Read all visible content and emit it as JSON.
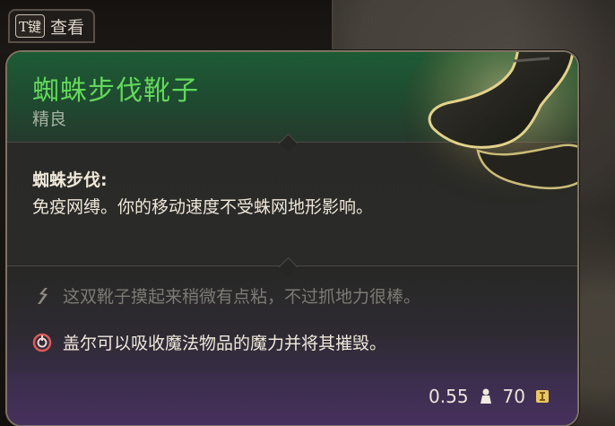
{
  "key_hint": {
    "key": "T键",
    "label": "查看"
  },
  "item": {
    "name": "蜘蛛步伐靴子",
    "rarity": "精良",
    "passive_name": "蜘蛛步伐:",
    "passive_desc": "免疫网缚。你的移动速度不受蛛网地形影响。",
    "flavor_text": "这双靴子摸起来稍微有点粘，不过抓地力很棒。",
    "note_text": "盖尔可以吸收魔法物品的魔力并将其摧毁。",
    "weight": "0.55",
    "value": "70"
  },
  "icons": {
    "weight": "weight-icon",
    "gold": "gold-icon",
    "flavor": "quill-icon",
    "note": "gale-hunger-icon",
    "item": "boots-icon"
  },
  "colors": {
    "title": "#62d85a",
    "header_bg": "#1d5b35",
    "footer_bg": "#46315c",
    "border": "#7d7364"
  }
}
